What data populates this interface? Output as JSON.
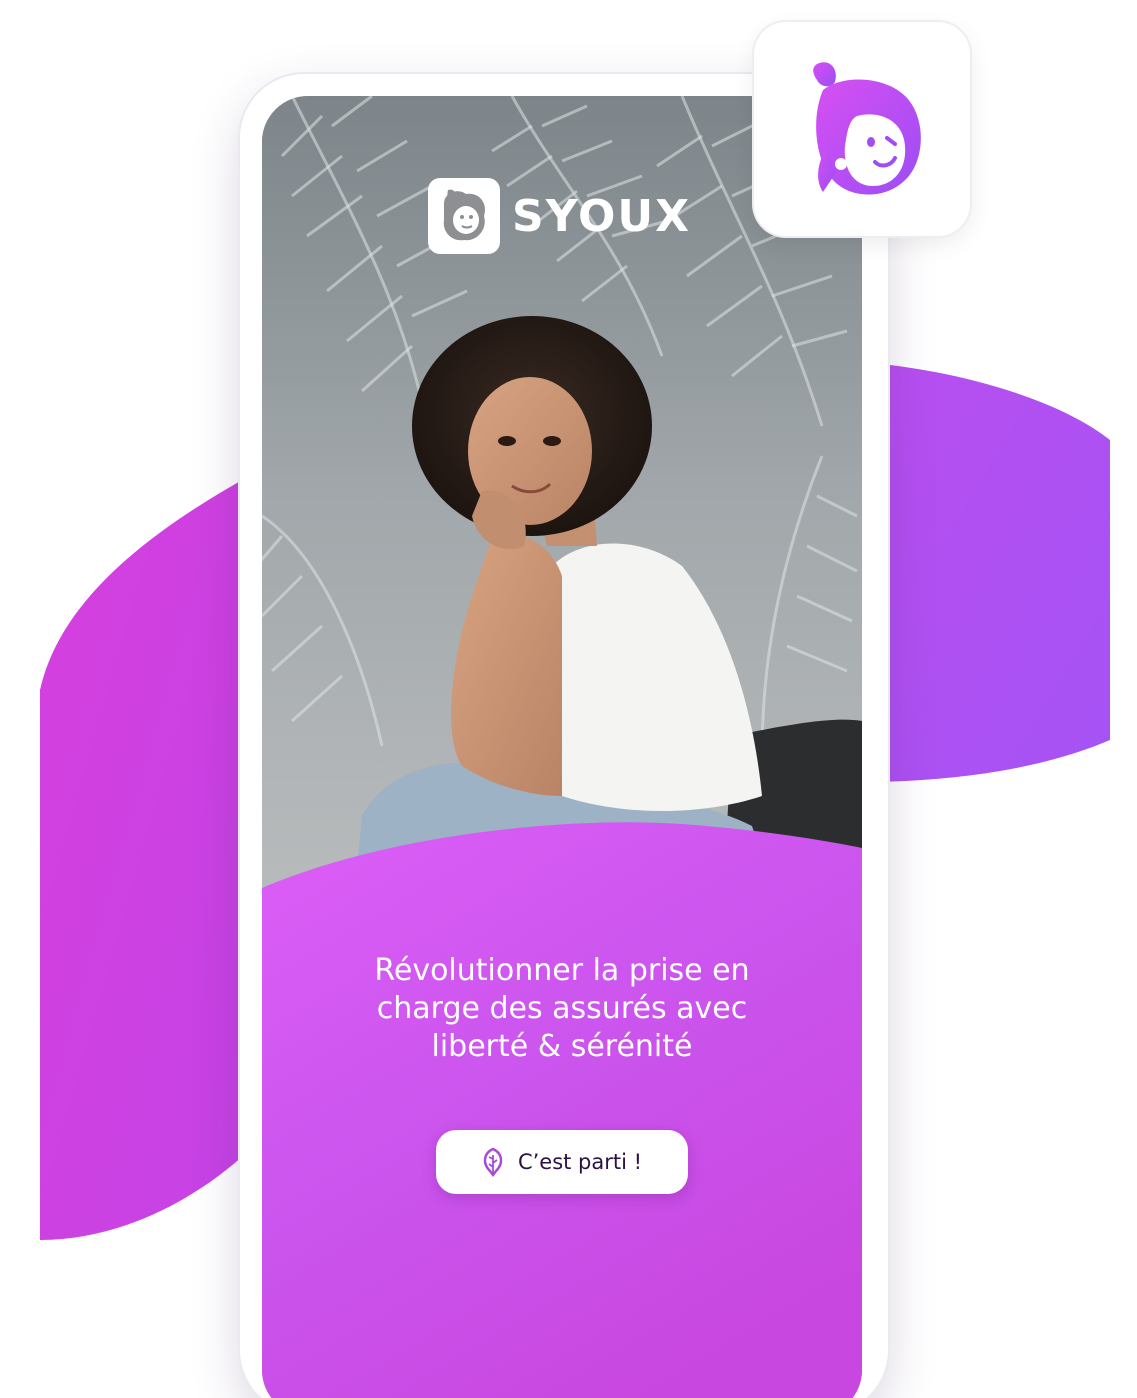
{
  "app": {
    "brand_name": "SYOUX"
  },
  "hero": {
    "headline_lines": [
      "Révolutionner la prise en",
      "charge des assurés avec",
      "liberté & sérénité"
    ]
  },
  "cta": {
    "label": "C’est parti !",
    "icon": "feather-icon"
  },
  "icons": {
    "app_icon": "syoux-mascot-icon",
    "brand_logo": "syoux-logo-icon"
  },
  "colors": {
    "accent_light": "#d95cf2",
    "accent_mid": "#c24fe6",
    "accent_dark": "#a855f7",
    "blob_left": "#cf3fe0",
    "blob_right": "#a552f2",
    "cta_text": "#2b1245"
  }
}
